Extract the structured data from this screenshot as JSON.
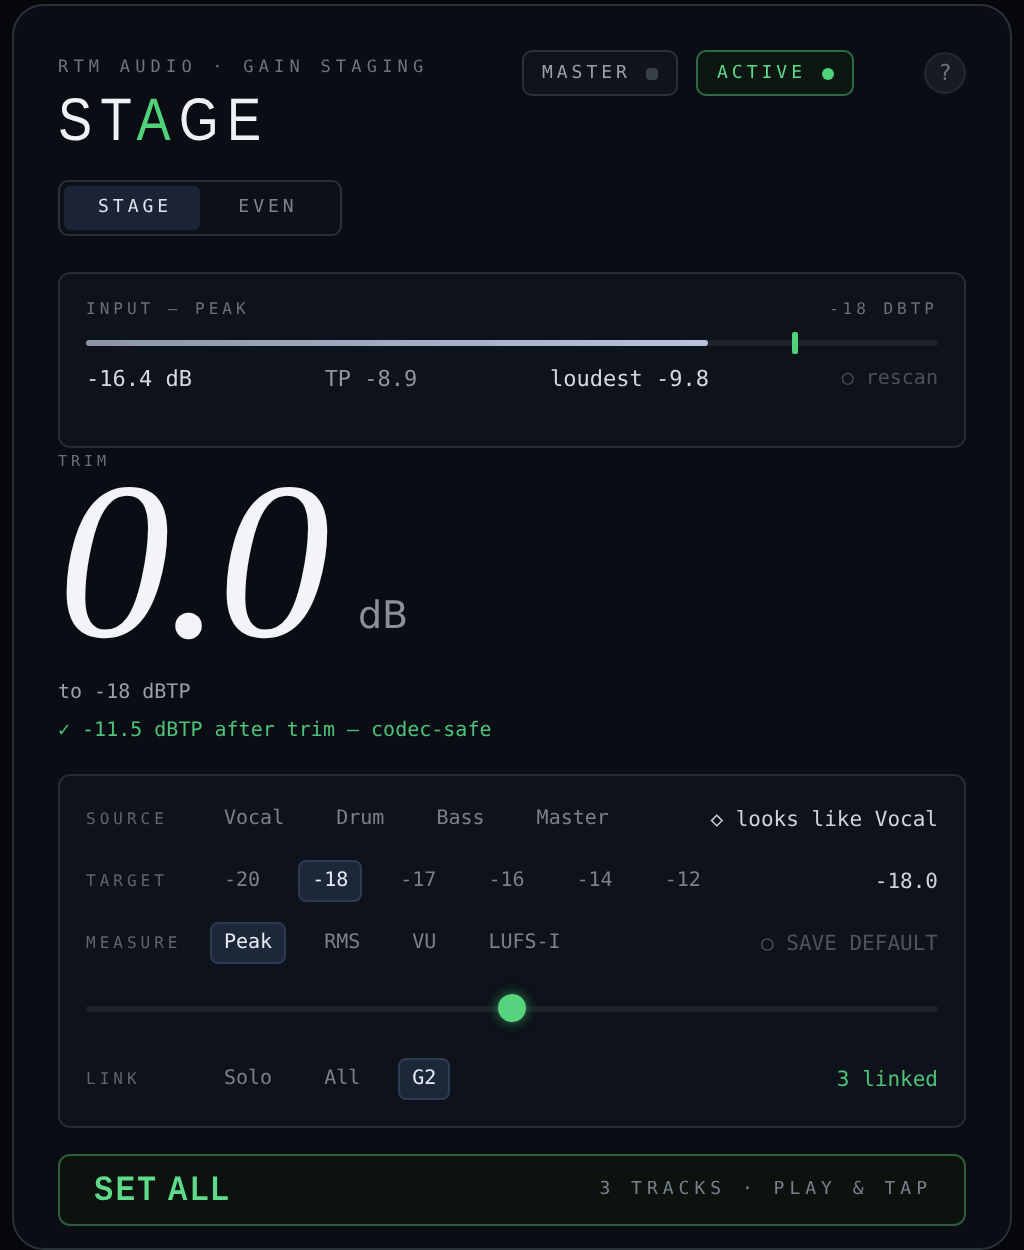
{
  "header": {
    "subtitle": "RTM AUDIO · GAIN STAGING",
    "title": "ST**A**GE",
    "buttons": [
      {
        "label": "MASTER",
        "on": false
      },
      {
        "label": "ACTIVE",
        "on": true
      }
    ],
    "help": "?"
  },
  "modes": [
    {
      "label": "STAGE",
      "selected": true
    },
    {
      "label": "EVEN",
      "selected": false
    }
  ],
  "input": {
    "label": "INPUT — PEAK",
    "target": "-18 DBTP",
    "level": 0.73,
    "target_marker": {
      "level": 0.83
    },
    "readings": [
      "-16.4 dB",
      "TP -8.9",
      "loudest -9.8"
    ],
    "rescan": "○ rescan"
  },
  "trim": {
    "label": "TRIM",
    "value": "0.0",
    "unit": "dB",
    "target_note": "to -18 dBTP",
    "status": "✓ -11.5 dBTP after trim — codec-safe"
  },
  "controls": {
    "rows": [
      {
        "kind": "options",
        "label": "SOURCE",
        "options": [
          {
            "label": "Vocal",
            "selected": false
          },
          {
            "label": "Drum",
            "selected": false
          },
          {
            "label": "Bass",
            "selected": false
          },
          {
            "label": "Master",
            "selected": false
          }
        ],
        "aside": {
          "text": "◇ looks like Vocal",
          "color": "#cfd5de"
        }
      },
      {
        "kind": "options",
        "label": "TARGET",
        "options": [
          {
            "label": "-20",
            "selected": false
          },
          {
            "label": "-18",
            "selected": true
          },
          {
            "label": "-17",
            "selected": false
          },
          {
            "label": "-16",
            "selected": false
          },
          {
            "label": "-14",
            "selected": false
          },
          {
            "label": "-12",
            "selected": false
          }
        ],
        "aside": {
          "text": "-18.0",
          "color": "#cfd5de"
        }
      },
      {
        "kind": "options",
        "label": "MEASURE",
        "options": [
          {
            "label": "Peak",
            "selected": true
          },
          {
            "label": "RMS",
            "selected": false
          },
          {
            "label": "VU",
            "selected": false
          },
          {
            "label": "LUFS-I",
            "selected": false
          }
        ],
        "aside": {
          "text": "○ SAVE DEFAULT",
          "color": "#4e545e"
        }
      },
      {
        "kind": "slider",
        "level": 0.5
      },
      {
        "kind": "options",
        "label": "LINK",
        "options": [
          {
            "label": "Solo",
            "selected": false
          },
          {
            "label": "All",
            "selected": false
          },
          {
            "label": "G2",
            "selected": true
          }
        ],
        "aside": {
          "text": "3 linked",
          "color": "#4fc27a"
        }
      }
    ]
  },
  "set_all": {
    "label": "SET ALL",
    "note": "3 TRACKS · PLAY & TAP"
  }
}
